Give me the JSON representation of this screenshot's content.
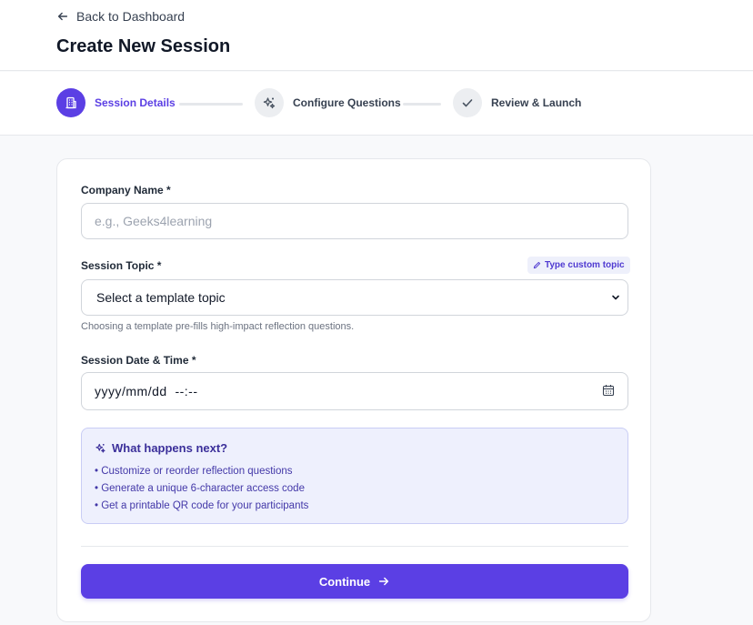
{
  "header": {
    "back_label": "Back to Dashboard",
    "title": "Create New Session"
  },
  "stepper": {
    "steps": [
      {
        "label": "Session Details",
        "state": "active",
        "icon": "building-icon"
      },
      {
        "label": "Configure Questions",
        "state": "inactive",
        "icon": "sparkles-icon"
      },
      {
        "label": "Review & Launch",
        "state": "inactive",
        "icon": "check-icon"
      }
    ]
  },
  "form": {
    "company": {
      "label": "Company Name *",
      "placeholder": "e.g., Geeks4learning",
      "value": ""
    },
    "topic": {
      "label": "Session Topic *",
      "custom_link": "Type custom topic",
      "selected": "Select a template topic",
      "hint": "Choosing a template pre-fills high-impact reflection questions."
    },
    "datetime": {
      "label": "Session Date & Time *",
      "value": "yyyy/mm/dd  --:--"
    }
  },
  "info": {
    "title": "What happens next?",
    "items": [
      "• Customize or reorder reflection questions",
      "• Generate a unique 6-character access code",
      "• Get a printable QR code for your participants"
    ]
  },
  "actions": {
    "continue_label": "Continue"
  },
  "colors": {
    "accent": "#5b3fe4",
    "info_bg": "#eef0fd",
    "info_text": "#4338a8"
  }
}
